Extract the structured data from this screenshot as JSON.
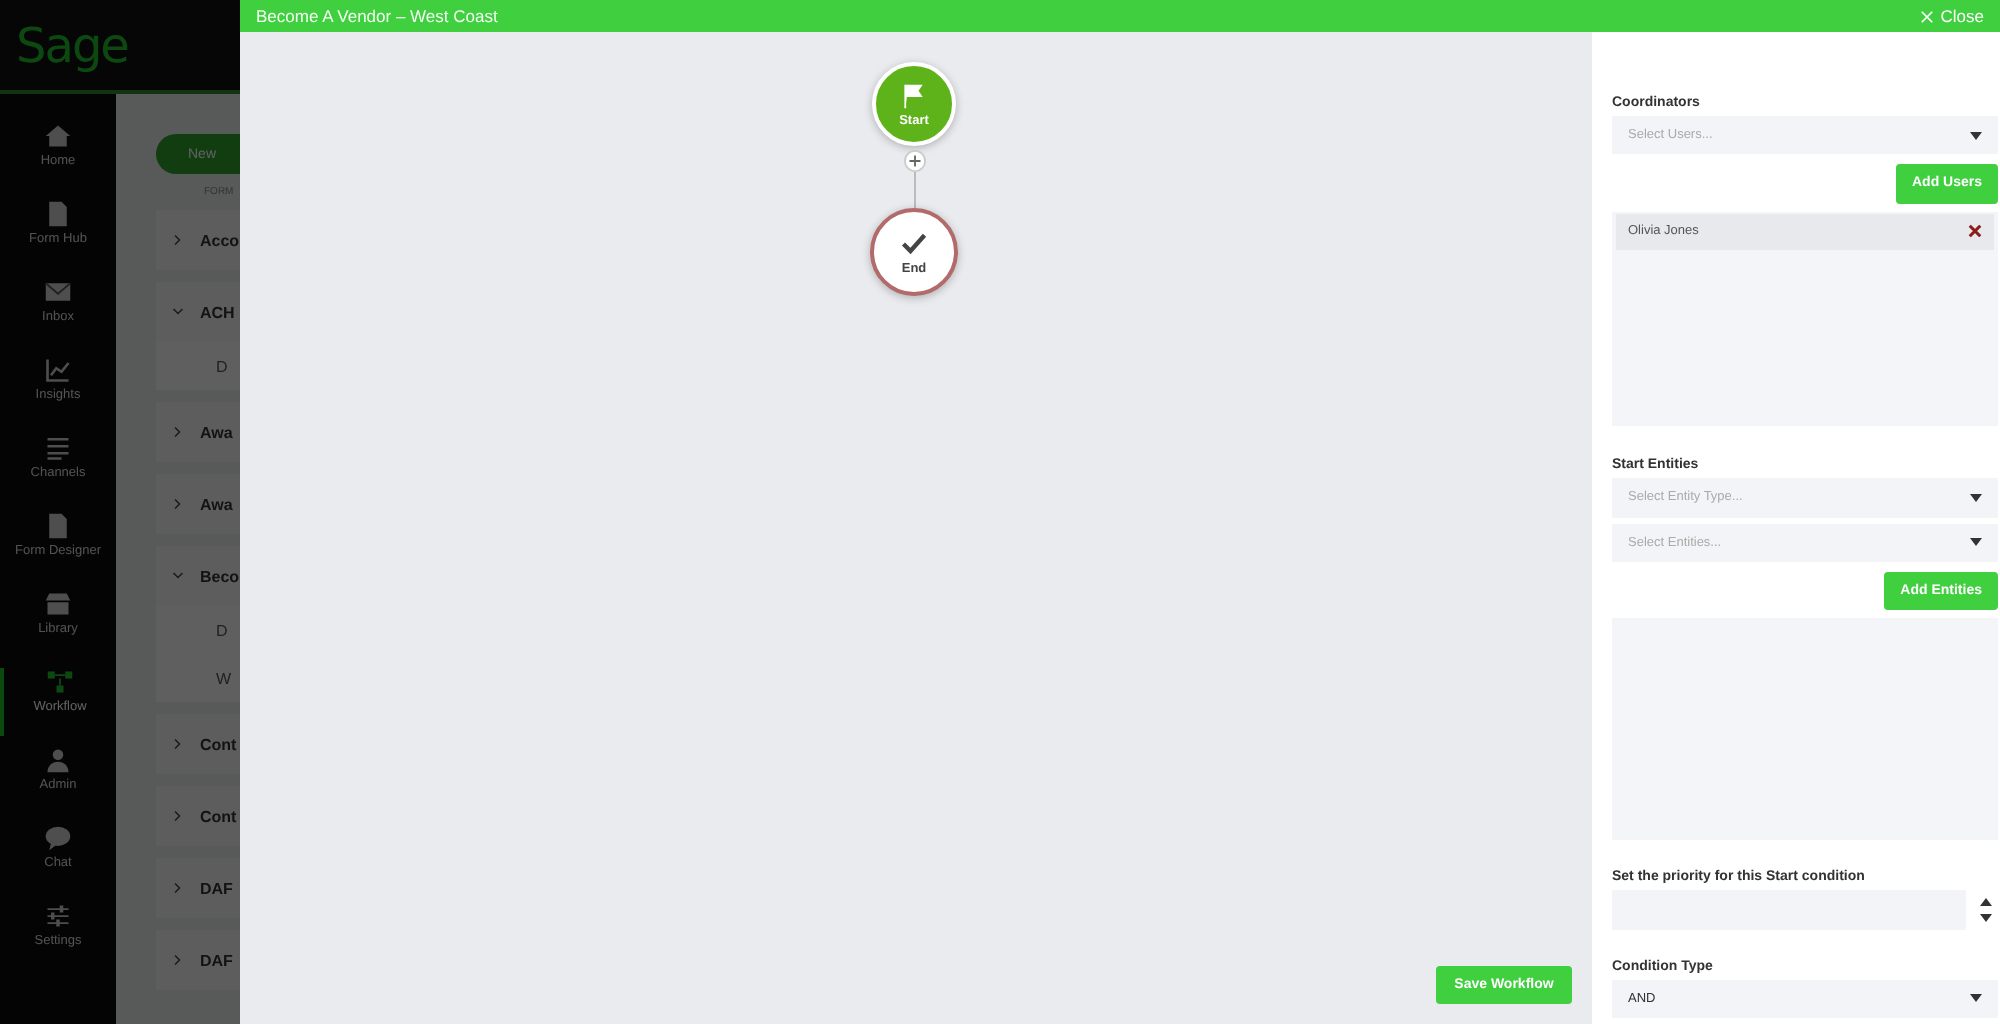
{
  "app": {
    "logo": "Sage",
    "nav": [
      {
        "label": "Home",
        "selected": false
      },
      {
        "label": "Form Hub",
        "selected": false
      },
      {
        "label": "Inbox",
        "selected": false
      },
      {
        "label": "Insights",
        "selected": false
      },
      {
        "label": "Channels",
        "selected": false
      },
      {
        "label": "Form Designer",
        "selected": false
      },
      {
        "label": "Library",
        "selected": false
      },
      {
        "label": "Workflow",
        "selected": true
      },
      {
        "label": "Admin",
        "selected": false
      },
      {
        "label": "Chat",
        "selected": false
      },
      {
        "label": "Settings",
        "selected": false
      }
    ],
    "new_button": "New",
    "breadcrumb": "FORM",
    "rows": [
      {
        "kind": "group",
        "label": "Acco",
        "expanded": false
      },
      {
        "kind": "group",
        "label": "ACH",
        "expanded": true
      },
      {
        "kind": "item",
        "label": "D"
      },
      {
        "kind": "group",
        "label": "Awa",
        "expanded": false
      },
      {
        "kind": "group",
        "label": "Awa",
        "expanded": false
      },
      {
        "kind": "group",
        "label": "Beco",
        "expanded": true
      },
      {
        "kind": "item",
        "label": "D"
      },
      {
        "kind": "item",
        "label": "W"
      },
      {
        "kind": "group",
        "label": "Cont",
        "expanded": false
      },
      {
        "kind": "group",
        "label": "Cont",
        "expanded": false
      },
      {
        "kind": "group",
        "label": "DAF",
        "expanded": false
      },
      {
        "kind": "group",
        "label": "DAF",
        "expanded": false
      }
    ]
  },
  "modal": {
    "title": "Become A Vendor – West Coast",
    "close": "Close",
    "nodes": [
      {
        "kind": "start",
        "label": "Start"
      },
      {
        "kind": "end",
        "label": "End"
      }
    ],
    "save_button": "Save Workflow",
    "panel": {
      "coordinators_label": "Coordinators",
      "users_select": {
        "placeholder": "Select Users..."
      },
      "add_users": "Add Users",
      "users": [
        {
          "name": "Olivia Jones"
        }
      ],
      "entities_label": "Start Entities",
      "entity_type_select": {
        "placeholder": "Select Entity Type..."
      },
      "entities_select": {
        "placeholder": "Select Entities..."
      },
      "add_entities": "Add Entities",
      "priority_label": "Set the priority for this Start condition",
      "condition_label": "Condition Type",
      "condition_select": {
        "value": "AND"
      }
    }
  }
}
